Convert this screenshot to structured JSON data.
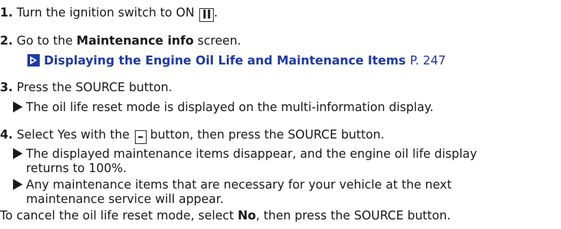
{
  "steps": [
    {
      "number": "1.",
      "text_before": "Turn the ignition switch to ON",
      "key_label": "II",
      "text_after": "."
    },
    {
      "number": "2.",
      "text_before": "Go to the",
      "bold_text": "Maintenance info",
      "text_after": "screen.",
      "reference": {
        "title": "Displaying the Engine Oil Life and Maintenance Items",
        "page": "P. 247"
      }
    },
    {
      "number": "3.",
      "text": "Press the SOURCE button.",
      "results": [
        "The oil life reset mode is displayed on the multi-information display."
      ]
    },
    {
      "number": "4.",
      "text_before": "Select Yes with the",
      "key_label": "–",
      "text_after": "button, then press the SOURCE button.",
      "results": [
        "The displayed maintenance items disappear, and the engine oil life display",
        "returns to 100%.",
        "Any maintenance items that are necessary for your vehicle at the next",
        "maintenance service will appear."
      ]
    }
  ],
  "cancel_note": {
    "text_before": "To cancel the oil life reset mode, select",
    "bold_text": "No",
    "text_after": ", then press the SOURCE button."
  },
  "colors": {
    "reference_link": "#1e3aa8",
    "text": "#1a1a1a"
  }
}
